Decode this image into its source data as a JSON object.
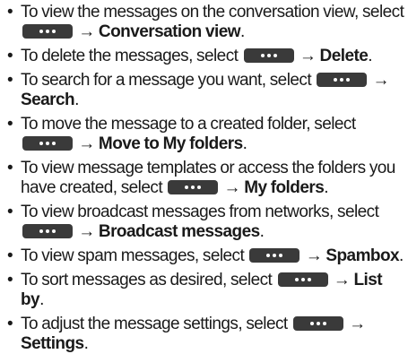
{
  "instructions": [
    {
      "bullet": "•",
      "before": "To view the messages on the conversation view, select ",
      "arrow": "→",
      "target": "Conversation view",
      "after": "."
    },
    {
      "bullet": "•",
      "before": "To delete the messages, select ",
      "arrow": "→",
      "target": "Delete",
      "after": "."
    },
    {
      "bullet": "•",
      "before": "To search for a message you want, select ",
      "arrow": "→",
      "target": "Search",
      "after": "."
    },
    {
      "bullet": "•",
      "before": "To move the message to a created folder, select ",
      "arrow": "→",
      "target": "Move to My folders",
      "after": "."
    },
    {
      "bullet": "•",
      "before": "To view message templates or access the folders you have created, select ",
      "arrow": "→",
      "target": "My folders",
      "after": "."
    },
    {
      "bullet": "•",
      "before": "To view broadcast messages from networks, select ",
      "arrow": "→",
      "target": "Broadcast messages",
      "after": "."
    },
    {
      "bullet": "•",
      "before": "To view spam messages, select ",
      "arrow": "→",
      "target": "Spambox",
      "after": "."
    },
    {
      "bullet": "•",
      "before": "To sort messages as desired, select ",
      "arrow": "→",
      "target": "List by",
      "after": "."
    },
    {
      "bullet": "•",
      "before": "To adjust the message settings, select ",
      "arrow": "→",
      "target": "Settings",
      "after": "."
    }
  ],
  "menu_button": {
    "icon": "more-options-icon",
    "color": "#3a3a3a"
  }
}
